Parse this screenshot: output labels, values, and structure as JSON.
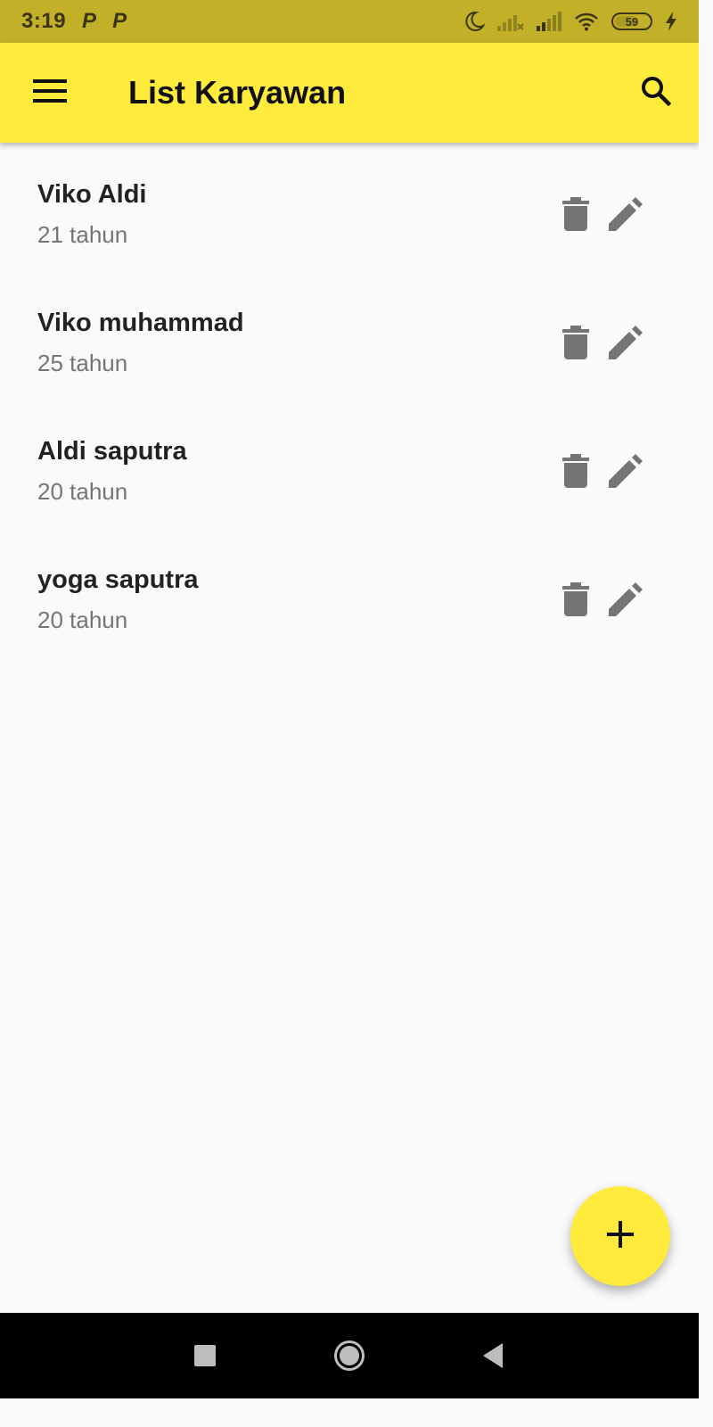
{
  "status_bar": {
    "time": "3:19",
    "notification_icons": [
      "P",
      "P"
    ],
    "battery_level": "59",
    "icons": [
      "moon-icon",
      "signal-icon",
      "signal-icon",
      "wifi-icon",
      "battery-icon",
      "charging-icon"
    ]
  },
  "app_bar": {
    "title": "List Karyawan",
    "menu_icon": "hamburger-menu-icon",
    "search_icon": "search-icon",
    "background_color": "#ffeb3b"
  },
  "employees": [
    {
      "name": "Viko Aldi",
      "age": "21 tahun"
    },
    {
      "name": "Viko muhammad",
      "age": "25 tahun"
    },
    {
      "name": "Aldi saputra",
      "age": "20 tahun"
    },
    {
      "name": "yoga saputra",
      "age": "20 tahun"
    }
  ],
  "item_actions": {
    "delete_icon": "trash-icon",
    "edit_icon": "pencil-icon",
    "icon_color": "#757575"
  },
  "fab": {
    "icon": "plus-icon",
    "background_color": "#ffeb3b"
  },
  "nav_bar": {
    "icons": [
      "recent-apps-icon",
      "home-icon",
      "back-icon"
    ]
  }
}
